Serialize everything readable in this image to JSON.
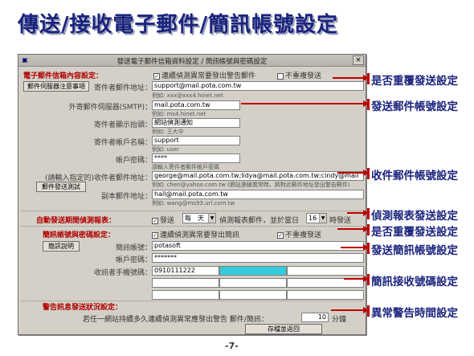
{
  "slide_title": "傳送/接收電子郵件/簡訊帳號設定",
  "window": {
    "title": "發送電子郵件信箱資料設定 / 簡訊帳號與密碼設定",
    "close_label": "×"
  },
  "email_section": {
    "heading": "電子郵件信箱內容設定：",
    "warn_checkbox": "連續偵測異常要發出警告郵件",
    "norepeat_checkbox": "不重複發送",
    "notes_button": "郵件伺服器注意事項",
    "sender_label": "寄件者郵件地址：",
    "sender_value": "support@mail.pota.com.tw",
    "sender_hint": "例如: xxx@xxx4.hinet.net",
    "smtp_label": "外寄郵件伺服器(SMTP)：",
    "smtp_value": "mail.pota.com.tw",
    "smtp_hint": "例如: ms4.hinet.net",
    "subject_label": "寄件者顯示抬頭：",
    "subject_value": "網站偵測通知",
    "subject_hint": "例如: 王大中",
    "account_label": "寄件者帳戶名稱：",
    "account_value": "support",
    "account_hint": "例如: user",
    "password_label": "帳戶密碼：",
    "password_value": "****",
    "password_hint": "請輸入寄件者郵件帳戶密碼",
    "recipient_label": "(請輸入指定的)收件者郵件地址：",
    "recipient_value": "george@mail.pota.com.tw;lidya@mail.pota.com.tw;cindy@mail",
    "recipient_hint": "例如: chen@yahoo.com.tw (網站連線異常時，將對此郵件地址發出警告郵件)",
    "test_button": "郵件發送測試",
    "cc_label": "副本郵件地址：",
    "cc_value": "hall@mail.pota.com.tw",
    "cc_hint": "例如: wang@ms93.url.com.tw"
  },
  "report_section": {
    "heading": "自動發送期間偵測報表：",
    "send_checkbox": "發送",
    "frequency": "每　天",
    "middle_text": "偵測報表郵件，並於當日",
    "hour": "16",
    "suffix": "時發送"
  },
  "sms_section": {
    "heading": "簡訊帳號與密碼設定：",
    "warn_checkbox": "連續偵測異常要發出簡訊",
    "norepeat_checkbox": "不重複發送",
    "help_button": "簡訊說明",
    "account_label": "簡訊帳號：",
    "account_value": "potasoft",
    "password_label": "帳戶密碼：",
    "password_value": "*******",
    "phones_label": "收訊者手機號碼：",
    "phones": [
      "0910111222",
      "",
      "",
      "",
      "",
      "",
      "",
      "",
      "",
      "",
      "",
      ""
    ]
  },
  "alert_section": {
    "heading": "警告訊息發送狀況設定：",
    "desc": "若任一網站持續多久連續偵測異常應發出警告 郵件/簡訊：",
    "minutes": "10",
    "unit": "分鐘",
    "save_button": "存檔並返回"
  },
  "annotations": [
    "是否重覆發送設定",
    "發送郵件帳號設定",
    "收件郵件帳號設定",
    "偵測報表發送設定",
    "是否重覆發送設定",
    "發送簡訊帳號設定",
    "簡訊接收號碼設定",
    "異常警告時間設定"
  ],
  "page_number": "-7-",
  "colors": {
    "title": "#1a237e",
    "section_heading": "#b00000",
    "arrow": "#c00000",
    "phone_highlight": "#33ccdd",
    "window_bg": "#d4d0c8"
  }
}
